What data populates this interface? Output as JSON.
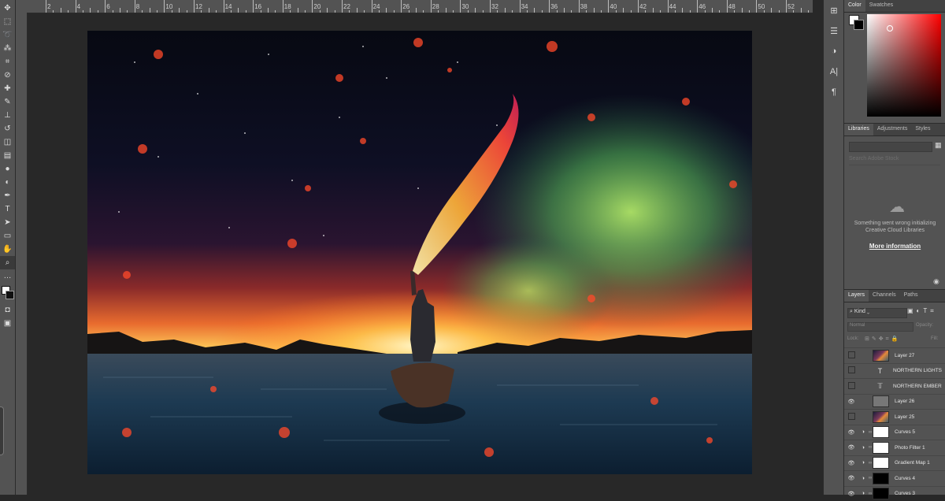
{
  "tools": [
    {
      "name": "move-tool-icon",
      "glyph": "✥"
    },
    {
      "name": "marquee-tool-icon",
      "glyph": "⬚"
    },
    {
      "name": "lasso-tool-icon",
      "glyph": "➰"
    },
    {
      "name": "magic-wand-tool-icon",
      "glyph": "⁂"
    },
    {
      "name": "crop-tool-icon",
      "glyph": "⌗"
    },
    {
      "name": "eyedropper-tool-icon",
      "glyph": "⊘"
    },
    {
      "name": "healing-brush-tool-icon",
      "glyph": "✚"
    },
    {
      "name": "brush-tool-icon",
      "glyph": "✎"
    },
    {
      "name": "clone-stamp-tool-icon",
      "glyph": "⊥"
    },
    {
      "name": "history-brush-tool-icon",
      "glyph": "↺"
    },
    {
      "name": "eraser-tool-icon",
      "glyph": "◫"
    },
    {
      "name": "gradient-tool-icon",
      "glyph": "▤"
    },
    {
      "name": "blur-tool-icon",
      "glyph": "●"
    },
    {
      "name": "dodge-tool-icon",
      "glyph": "◐"
    },
    {
      "name": "pen-tool-icon",
      "glyph": "✒"
    },
    {
      "name": "type-tool-icon",
      "glyph": "T"
    },
    {
      "name": "path-selection-tool-icon",
      "glyph": "➤"
    },
    {
      "name": "rectangle-tool-icon",
      "glyph": "▭"
    },
    {
      "name": "hand-tool-icon",
      "glyph": "✋"
    },
    {
      "name": "zoom-tool-icon",
      "glyph": "⌕"
    },
    {
      "name": "edit-toolbar-icon",
      "glyph": "…"
    }
  ],
  "ruler_top_labels": [
    "2",
    "4",
    "6",
    "8",
    "10",
    "12",
    "14",
    "16",
    "18",
    "20",
    "22",
    "24",
    "26",
    "28",
    "30",
    "32",
    "34",
    "36",
    "38",
    "40",
    "42",
    "44",
    "46",
    "48",
    "50",
    "52"
  ],
  "dock_icons": [
    {
      "name": "history-panel-icon",
      "glyph": "⊞"
    },
    {
      "name": "properties-panel-icon",
      "glyph": "☰"
    },
    {
      "name": "adjustments-panel-icon",
      "glyph": "◑"
    },
    {
      "name": "character-panel-icon",
      "glyph": "A|"
    },
    {
      "name": "paragraph-panel-icon",
      "glyph": "¶"
    }
  ],
  "color_panel": {
    "tabs": [
      "Color",
      "Swatches"
    ],
    "hue": "#ff0000"
  },
  "libraries_panel": {
    "tabs": [
      "Libraries",
      "Adjustments",
      "Styles"
    ],
    "search_placeholder": "Search Adobe Stock",
    "error_line1": "Something went wrong initializing",
    "error_line2": "Creative Cloud Libraries",
    "more_info": "More information"
  },
  "layers_panel": {
    "tabs": [
      "Layers",
      "Channels",
      "Paths"
    ],
    "filter_kind": "Kind",
    "blend_mode": "Normal",
    "opacity_label": "Opacity:",
    "lock_label": "Lock:",
    "fill_label": "Fill:",
    "layers": [
      {
        "name": "Layer 27",
        "visible": false,
        "thumb": "photo",
        "adjustment": false
      },
      {
        "name": "NORTHERN LIGHTS",
        "visible": false,
        "thumb": "type-T",
        "adjustment": false
      },
      {
        "name": "NORTHERN EMBER",
        "visible": false,
        "thumb": "type-warp",
        "adjustment": false
      },
      {
        "name": "Layer 26",
        "visible": true,
        "thumb": "gray",
        "adjustment": false
      },
      {
        "name": "Layer 25",
        "visible": false,
        "thumb": "photo",
        "adjustment": false
      },
      {
        "name": "Curves 5",
        "visible": true,
        "thumb": "white",
        "adjustment": true
      },
      {
        "name": "Photo Filter 1",
        "visible": true,
        "thumb": "white",
        "adjustment": true
      },
      {
        "name": "Gradient Map 1",
        "visible": true,
        "thumb": "white",
        "adjustment": true
      },
      {
        "name": "Curves 4",
        "visible": true,
        "thumb": "black",
        "adjustment": true
      },
      {
        "name": "Curves 3",
        "visible": true,
        "thumb": "black",
        "adjustment": true
      }
    ]
  }
}
